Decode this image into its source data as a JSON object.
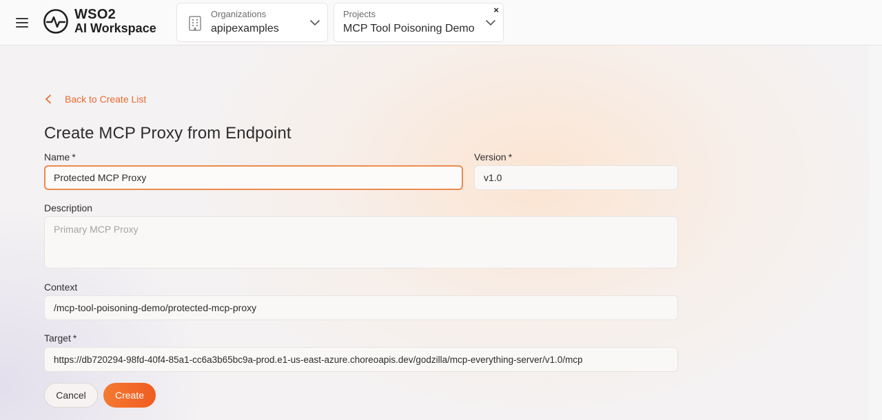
{
  "header": {
    "logo_line1": "WSO2",
    "logo_line2": "AI Workspace",
    "org_selector": {
      "label": "Organizations",
      "value": "apipexamples"
    },
    "project_selector": {
      "label": "Projects",
      "value": "MCP Tool Poisoning Demo",
      "close": "×"
    }
  },
  "main": {
    "back_link": "Back to Create List",
    "title": "Create MCP Proxy from Endpoint",
    "required_mark": "*",
    "fields": {
      "name": {
        "label": "Name",
        "value": "Protected MCP Proxy"
      },
      "version": {
        "label": "Version",
        "value": "v1.0"
      },
      "description": {
        "label": "Description",
        "placeholder": "Primary MCP Proxy"
      },
      "context": {
        "label": "Context",
        "value": "/mcp-tool-poisoning-demo/protected-mcp-proxy"
      },
      "target": {
        "label": "Target",
        "value": "https://db720294-98fd-40f4-85a1-cc6a3b65bc9a-prod.e1-us-east-azure.choreoapis.dev/godzilla/mcp-everything-server/v1.0/mcp"
      }
    },
    "buttons": {
      "cancel": "Cancel",
      "create": "Create"
    }
  },
  "colors": {
    "accent": "#F06424",
    "link": "#E86A2F",
    "focus_border": "#EC8A4F"
  },
  "icons": [
    "menu-icon",
    "wso2-logo-icon",
    "building-icon",
    "chevron-down-icon",
    "close-icon",
    "chevron-left-icon"
  ]
}
